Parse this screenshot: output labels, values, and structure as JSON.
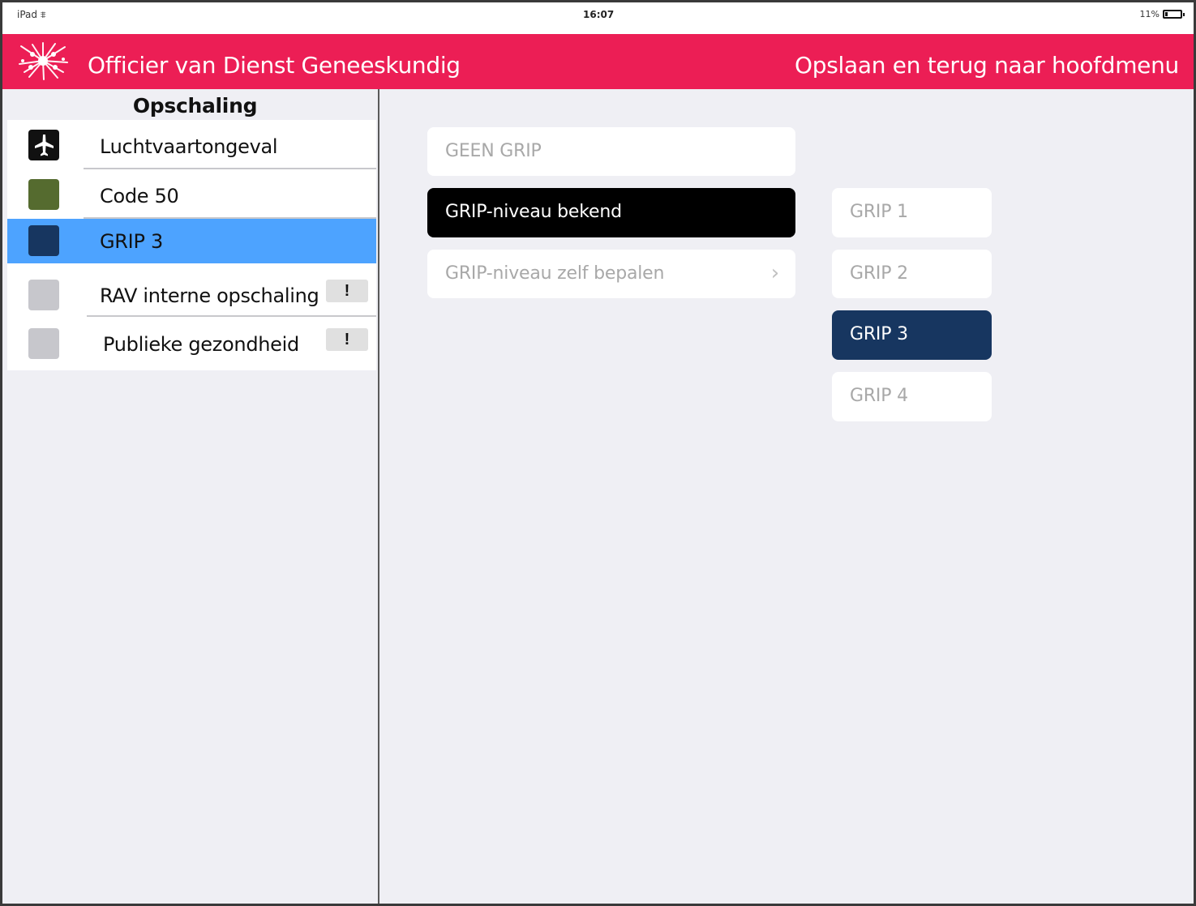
{
  "statusbar": {
    "carrier": "iPad",
    "time": "16:07",
    "battery": "11%"
  },
  "header": {
    "title": "Officier van Dienst Geneeskundig",
    "save_back": "Opslaan en terug naar hoofdmenu"
  },
  "sidebar": {
    "heading": "Opschaling",
    "items": [
      {
        "label": "Luchtvaartongeval",
        "icon": "airplane-icon",
        "color": "#111111",
        "badge": ""
      },
      {
        "label": "Code 50",
        "icon": "color-swatch",
        "color": "#556b2f",
        "badge": ""
      },
      {
        "label": "GRIP 3",
        "icon": "color-swatch",
        "color": "#173660",
        "badge": "",
        "selected": true
      },
      {
        "label": "RAV interne opschaling",
        "icon": "color-swatch",
        "color": "#c7c7cc",
        "badge": "!"
      },
      {
        "label": "Publieke gezondheid",
        "icon": "color-swatch",
        "color": "#c7c7cc",
        "badge": "!"
      }
    ]
  },
  "main": {
    "options": [
      {
        "label": "GEEN GRIP"
      },
      {
        "label": "GRIP-niveau bekend",
        "selected": true
      },
      {
        "label": "GRIP-niveau zelf bepalen",
        "chevron": "chevron-right-icon"
      }
    ],
    "grip_levels": [
      {
        "label": "GRIP 1"
      },
      {
        "label": "GRIP 2"
      },
      {
        "label": "GRIP 3",
        "selected": true
      },
      {
        "label": "GRIP 4"
      }
    ]
  },
  "colors": {
    "header_bg": "#ec1e55",
    "selection_blue": "#4da3ff",
    "navy": "#173660",
    "background": "#efeff4"
  }
}
